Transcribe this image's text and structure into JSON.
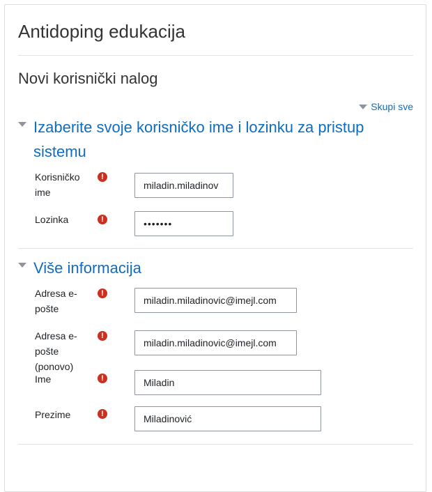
{
  "site": {
    "title": "Antidoping edukacija"
  },
  "page": {
    "title": "Novi korisnički nalog"
  },
  "collapse_all": {
    "label": "Skupi sve"
  },
  "sections": [
    {
      "title": "Izaberite svoje korisničko ime i lozinku za pristup sistemu",
      "fields": [
        {
          "label": "Korisničko ime",
          "value": "miladin.miladinov",
          "required": true
        },
        {
          "label": "Lozinka",
          "value": "•••••••",
          "required": true,
          "type": "password"
        }
      ]
    },
    {
      "title": "Više informacija",
      "fields": [
        {
          "label": "Adresa e-pošte",
          "value": "miladin.miladinovic@imejl.com",
          "required": true
        },
        {
          "label": "Adresa e-pošte (ponovo)",
          "value": "miladin.miladinovic@imejl.com",
          "required": true
        },
        {
          "label": "Ime",
          "value": "Miladin",
          "required": true
        },
        {
          "label": "Prezime",
          "value": "Miladinović",
          "required": true
        }
      ]
    }
  ],
  "colors": {
    "link": "#0f6cbf",
    "required": "#ca3120",
    "border": "#8f959e"
  },
  "icons": {
    "required": "exclamation-circle-icon",
    "collapse": "caret-down-icon"
  }
}
